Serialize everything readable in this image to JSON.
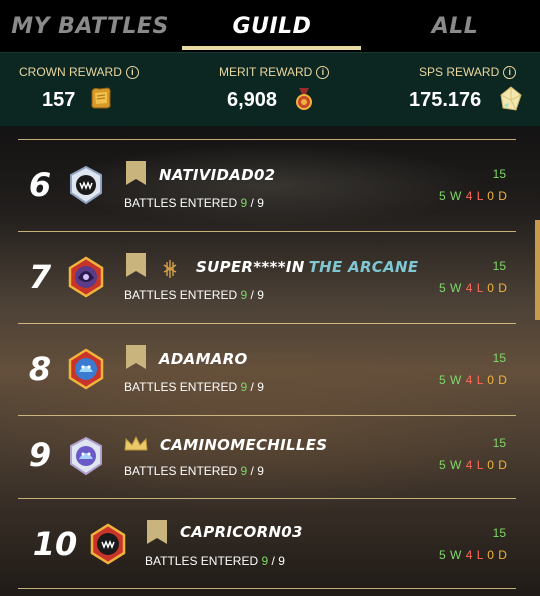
{
  "tabs": [
    {
      "label": "MY BATTLES",
      "active": false
    },
    {
      "label": "GUILD",
      "active": true
    },
    {
      "label": "ALL",
      "active": false
    }
  ],
  "rewards": {
    "crown": {
      "label": "CROWN REWARD",
      "value": "157",
      "icon": "crown-token-icon"
    },
    "merit": {
      "label": "MERIT REWARD",
      "value": "6,908",
      "icon": "merit-medal-icon"
    },
    "sps": {
      "label": "SPS REWARD",
      "value": "175.176",
      "icon": "sps-crystal-icon"
    }
  },
  "battles_label": "BATTLES ENTERED",
  "rows": [
    {
      "rank": "6",
      "name": "NATIVIDAD02",
      "guild": "",
      "battles_entered": "9",
      "battles_total": "9",
      "score": "15",
      "wins": "5",
      "losses": "4",
      "draws": "0",
      "league_icon": "bronze-banner-icon"
    },
    {
      "rank": "7",
      "name": "SUPER****IN",
      "guild": "THE ARCANE",
      "battles_entered": "9",
      "battles_total": "9",
      "score": "15",
      "wins": "5",
      "losses": "4",
      "draws": "0",
      "league_icon": "bronze-banner-icon"
    },
    {
      "rank": "8",
      "name": "ADAMARO",
      "guild": "",
      "battles_entered": "9",
      "battles_total": "9",
      "score": "15",
      "wins": "5",
      "losses": "4",
      "draws": "0",
      "league_icon": "bronze-banner-icon"
    },
    {
      "rank": "9",
      "name": "CAMINOMECHILLES",
      "guild": "",
      "battles_entered": "9",
      "battles_total": "9",
      "score": "15",
      "wins": "5",
      "losses": "4",
      "draws": "0",
      "league_icon": "crown-icon"
    },
    {
      "rank": "10",
      "name": "CAPRICORN03",
      "guild": "",
      "battles_entered": "9",
      "battles_total": "9",
      "score": "15",
      "wins": "5",
      "losses": "4",
      "draws": "0",
      "league_icon": "bronze-banner-icon"
    }
  ],
  "colors": {
    "accent": "#e9d9a2",
    "win": "#7fd86a",
    "loss": "#ff6a5a",
    "draw": "#f0b43c",
    "guild": "#7fc7d2",
    "reward_bar": "#0c2622"
  }
}
